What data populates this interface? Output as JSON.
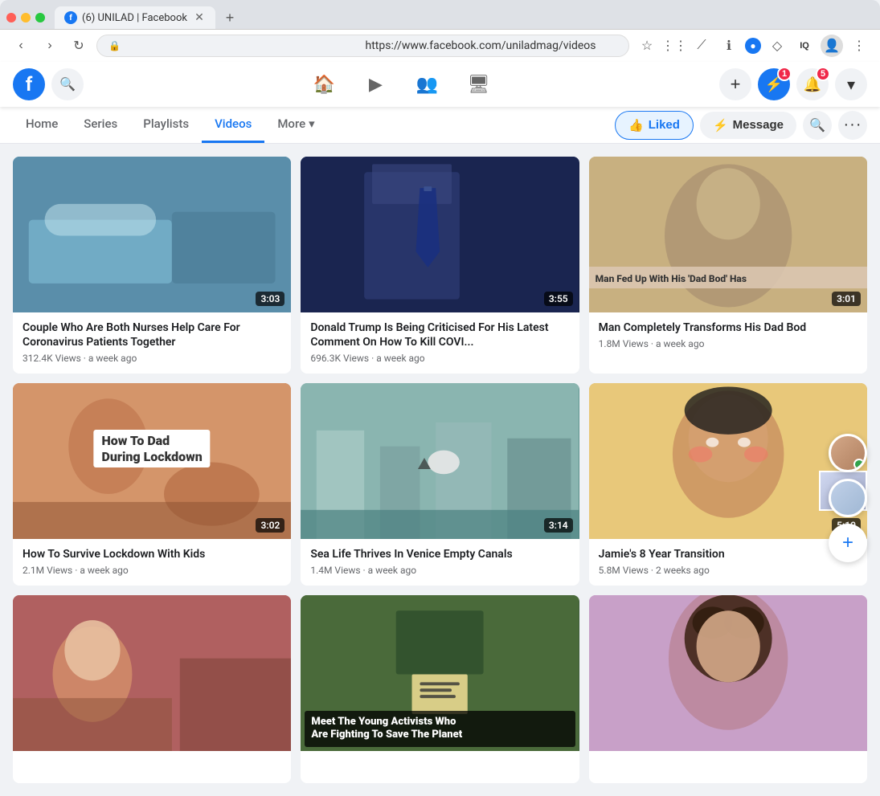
{
  "browser": {
    "tab_title": "(6) UNILAD | Facebook",
    "url": "https://www.facebook.com/uniladmag/videos",
    "new_tab_label": "+"
  },
  "header": {
    "logo_text": "f",
    "nav_icons": [
      "🏠",
      "▶",
      "👥",
      "🖥"
    ],
    "actions": {
      "plus": "+",
      "messenger_badge": "1",
      "bell_badge": "5"
    }
  },
  "page_nav": {
    "items": [
      {
        "label": "Home",
        "active": false
      },
      {
        "label": "Series",
        "active": false
      },
      {
        "label": "Playlists",
        "active": false
      },
      {
        "label": "Videos",
        "active": true
      },
      {
        "label": "More",
        "active": false
      }
    ],
    "liked_label": "Liked",
    "message_label": "Message"
  },
  "videos": [
    {
      "id": 1,
      "title": "Couple Who Are Both Nurses Help Care For Coronavirus Patients Together",
      "duration": "3:03",
      "views": "312.4K Views",
      "age": "a week ago",
      "thumb_class": "thumb-1"
    },
    {
      "id": 2,
      "title": "Donald Trump Is Being Criticised For His Latest Comment On How To Kill COVI...",
      "duration": "3:55",
      "views": "696.3K Views",
      "age": "a week ago",
      "thumb_class": "thumb-2",
      "overlay_text": ""
    },
    {
      "id": 3,
      "title": "Man Completely Transforms His Dad Bod",
      "duration": "3:01",
      "views": "1.8M Views",
      "age": "a week ago",
      "thumb_class": "thumb-3",
      "overlay_text": "Man Fed Up With His 'Dad Bod' Has"
    },
    {
      "id": 4,
      "title": "How To Survive Lockdown With Kids",
      "duration": "3:02",
      "views": "2.1M Views",
      "age": "a week ago",
      "thumb_class": "thumb-4",
      "overlay_text": "How To Dad\nDuring Lockdown"
    },
    {
      "id": 5,
      "title": "Sea Life Thrives In Venice Empty Canals",
      "duration": "3:14",
      "views": "1.4M Views",
      "age": "a week ago",
      "thumb_class": "thumb-5"
    },
    {
      "id": 6,
      "title": "Jamie's 8 Year Transition",
      "duration": "5:10",
      "views": "5.8M Views",
      "age": "2 weeks ago",
      "thumb_class": "thumb-6"
    },
    {
      "id": 7,
      "title": "Meet The Young Activists Who Are Fighting To Save The Planet",
      "duration": "",
      "views": "",
      "age": "",
      "thumb_class": "thumb-7",
      "overlay_text": "Meet The Young Activists Who\nAre Fighting To Save The Planet"
    },
    {
      "id": 8,
      "title": "",
      "duration": "",
      "views": "",
      "age": "",
      "thumb_class": "thumb-8"
    },
    {
      "id": 9,
      "title": "",
      "duration": "",
      "views": "",
      "age": "",
      "thumb_class": "thumb-9"
    }
  ]
}
